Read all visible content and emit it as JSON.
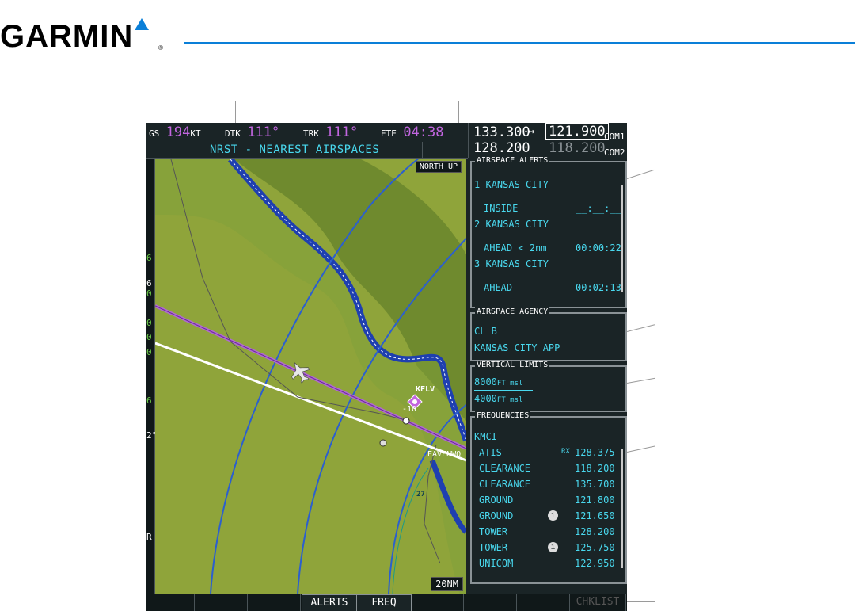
{
  "brand": {
    "name": "GARMIN",
    "registered_mark": "®"
  },
  "top_bar": {
    "gs_label": "GS",
    "gs_value": "194",
    "gs_unit": "KT",
    "dtk_label": "DTK",
    "dtk_value": "111°",
    "trk_label": "TRK",
    "trk_value": "111°",
    "ete_label": "ETE",
    "ete_value": "04:38"
  },
  "page_title": "NRST - NEAREST AIRSPACES",
  "com": {
    "com1_standby": "133.300",
    "com1_active": "121.900",
    "com1_label": "COM1",
    "com2_standby": "128.200",
    "com2_active": "118.200",
    "com2_label": "COM2",
    "swap_symbol": "↔"
  },
  "left_strip": {
    "items": [
      "6",
      "6",
      "0",
      "0",
      "0",
      "0",
      "6",
      "2°",
      "R"
    ]
  },
  "map": {
    "orientation": "NORTH UP",
    "range": "20NM",
    "airport_label": "KFLV",
    "altitude_label": "-10",
    "sector_label": "27",
    "town_label": "LEAVENWO"
  },
  "airspace_alerts": {
    "title": "AIRSPACE ALERTS",
    "items": [
      {
        "num": "1",
        "name": "KANSAS CITY",
        "status": "INSIDE",
        "time": "__:__:__"
      },
      {
        "num": "2",
        "name": "KANSAS CITY",
        "status": "AHEAD < 2nm",
        "time": "00:00:22"
      },
      {
        "num": "3",
        "name": "KANSAS CITY",
        "status": "AHEAD",
        "time": "00:02:13"
      }
    ]
  },
  "airspace_agency": {
    "title": "AIRSPACE AGENCY",
    "class": "CL B",
    "agency": "KANSAS CITY APP"
  },
  "vertical_limits": {
    "title": "VERTICAL LIMITS",
    "upper_value": "8000",
    "upper_unit": "FT msl",
    "lower_value": "4000",
    "lower_unit": "FT msl"
  },
  "frequencies": {
    "title": "FREQUENCIES",
    "facility": "KMCI",
    "rows": [
      {
        "name": "ATIS",
        "flag": "RX",
        "info": "",
        "freq": "128.375"
      },
      {
        "name": "CLEARANCE",
        "flag": "",
        "info": "",
        "freq": "118.200"
      },
      {
        "name": "CLEARANCE",
        "flag": "",
        "info": "",
        "freq": "135.700"
      },
      {
        "name": "GROUND",
        "flag": "",
        "info": "",
        "freq": "121.800"
      },
      {
        "name": "GROUND",
        "flag": "",
        "info": "i",
        "freq": "121.650"
      },
      {
        "name": "TOWER",
        "flag": "",
        "info": "",
        "freq": "128.200"
      },
      {
        "name": "TOWER",
        "flag": "",
        "info": "i",
        "freq": "125.750"
      },
      {
        "name": "UNICOM",
        "flag": "",
        "info": "",
        "freq": "122.950"
      }
    ]
  },
  "softkeys": {
    "alerts": "ALERTS",
    "freq": "FREQ",
    "check": "CHKLIST"
  },
  "colors": {
    "cyan": "#49d8ee",
    "magenta": "#c266e0",
    "map_terrain": "#8fa43a",
    "water": "#1e3fb0",
    "brand_blue": "#0a7fd8"
  }
}
